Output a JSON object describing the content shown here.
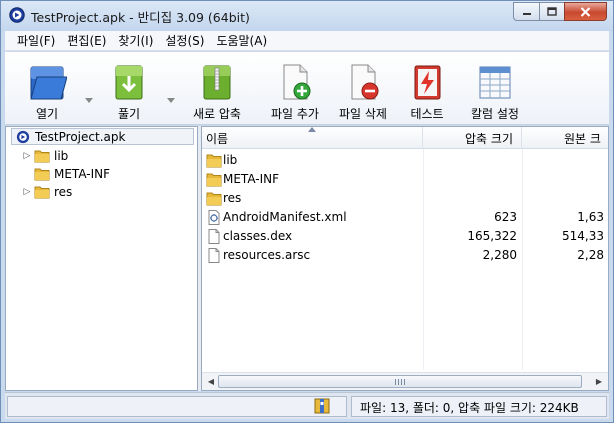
{
  "window": {
    "title": "TestProject.apk - 반디집 3.09 (64bit)"
  },
  "menu": [
    "파일(F)",
    "편집(E)",
    "찾기(I)",
    "설정(S)",
    "도움말(A)"
  ],
  "toolbar": {
    "open": "열기",
    "extract": "풀기",
    "new_archive": "새로 압축",
    "add_file": "파일 추가",
    "delete_file": "파일 삭제",
    "test": "테스트",
    "column_settings": "칼럼 설정"
  },
  "tree": {
    "root": "TestProject.apk",
    "items": [
      "lib",
      "META-INF",
      "res"
    ]
  },
  "columns": {
    "name": "이름",
    "compressed": "압축 크기",
    "original": "원본 크"
  },
  "files": [
    {
      "name": "lib",
      "type": "folder",
      "compressed": "",
      "original": ""
    },
    {
      "name": "META-INF",
      "type": "folder",
      "compressed": "",
      "original": ""
    },
    {
      "name": "res",
      "type": "folder",
      "compressed": "",
      "original": ""
    },
    {
      "name": "AndroidManifest.xml",
      "type": "xml",
      "compressed": "623",
      "original": "1,63"
    },
    {
      "name": "classes.dex",
      "type": "file",
      "compressed": "165,322",
      "original": "514,33"
    },
    {
      "name": "resources.arsc",
      "type": "file",
      "compressed": "2,280",
      "original": "2,28"
    }
  ],
  "status": {
    "summary": "파일: 13, 폴더: 0, 압축 파일 크기: 224KB"
  },
  "colors": {
    "folder": "#e7b93a",
    "title_bg": "#c9d9ee",
    "close_button": "#c8482f"
  }
}
